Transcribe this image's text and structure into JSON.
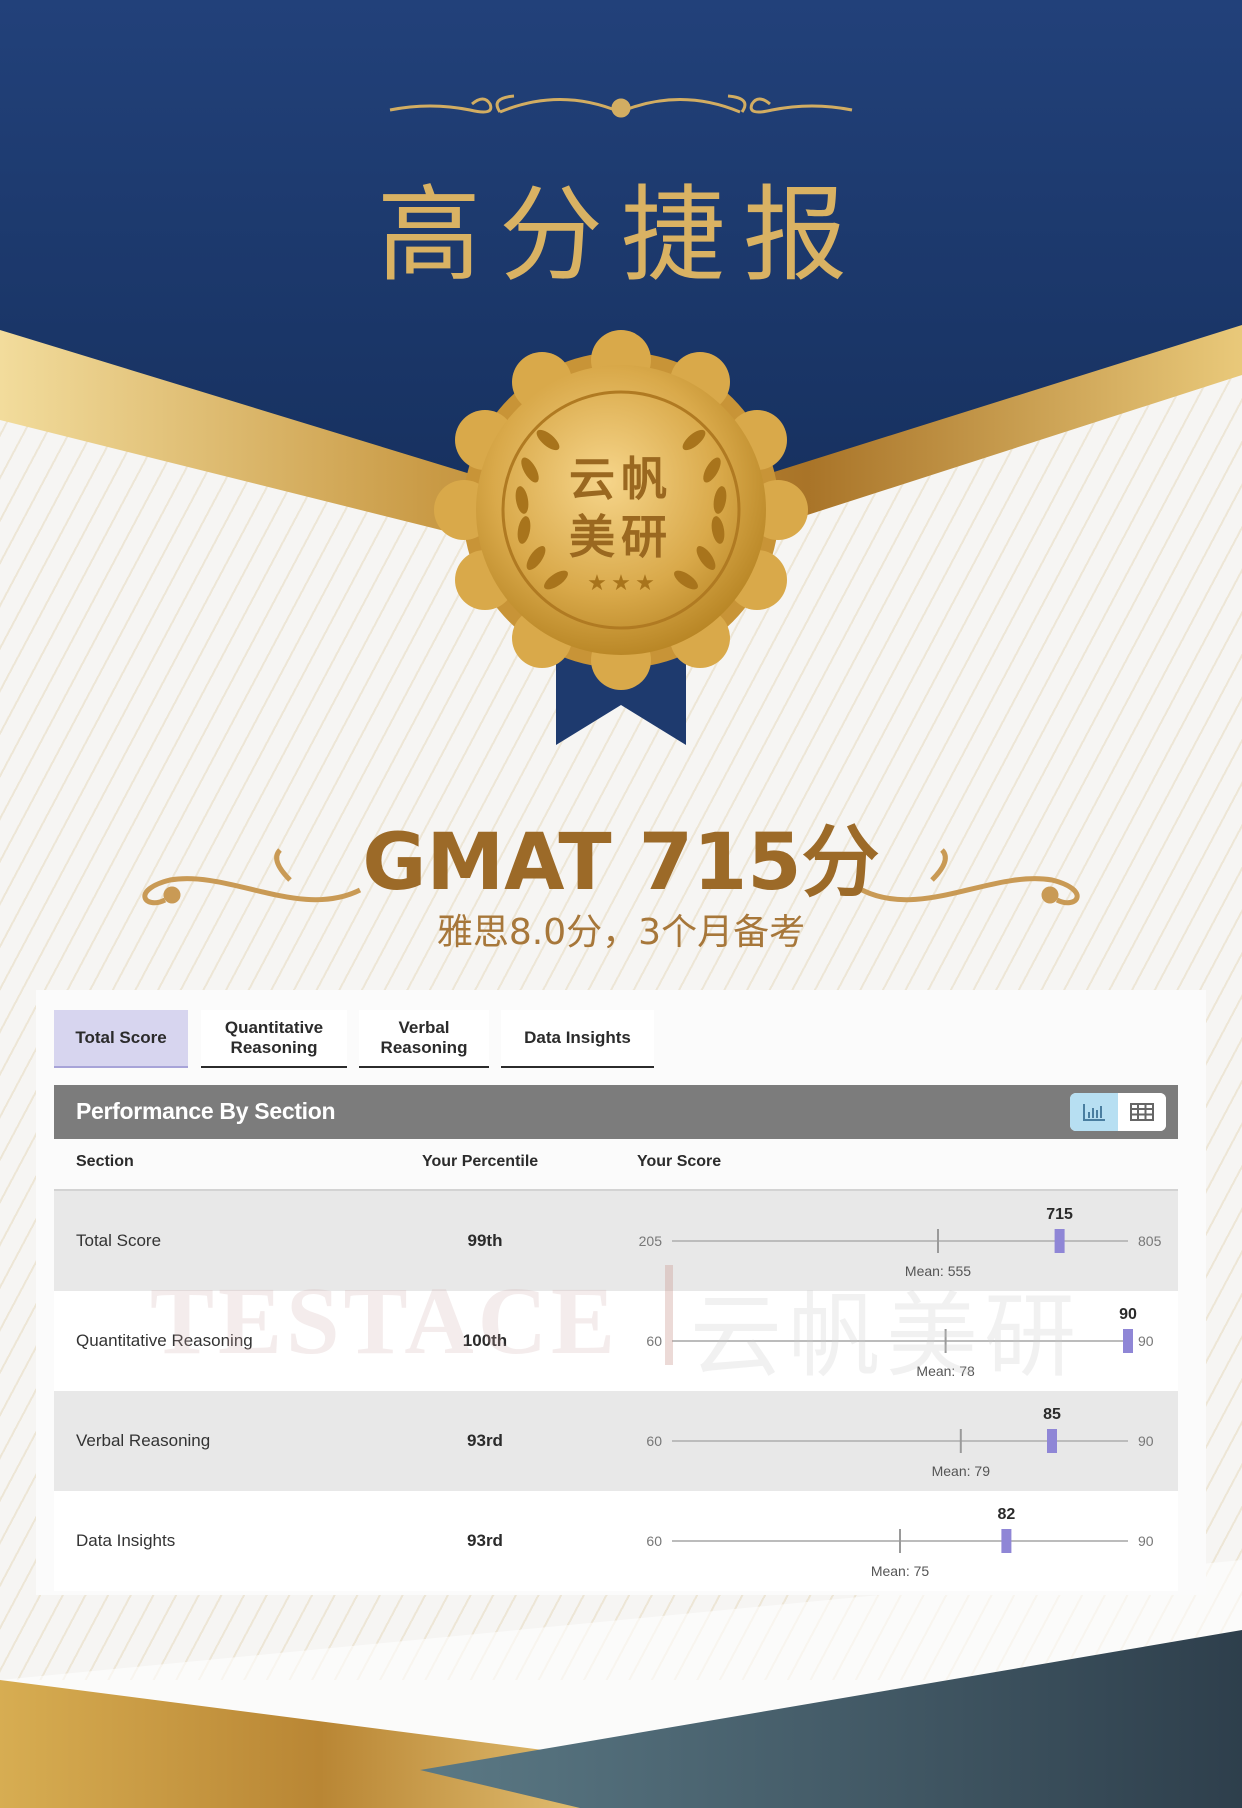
{
  "poster": {
    "title": "高分捷报",
    "seal_line1": "云帆",
    "seal_line2": "美研",
    "headline": "GMAT 715分",
    "subline": "雅思8.0分，3个月备考",
    "watermark_en": "TESTACE",
    "watermark_cn": "云帆美研"
  },
  "colors": {
    "navy": "#1f3a6e",
    "gold": "#d9b263",
    "accent_purple": "#8f86d6"
  },
  "tabs": [
    {
      "label": "Total Score",
      "active": true
    },
    {
      "label": "Quantitative Reasoning",
      "active": false
    },
    {
      "label": "Verbal Reasoning",
      "active": false
    },
    {
      "label": "Data Insights",
      "active": false
    }
  ],
  "performance": {
    "title": "Performance By Section",
    "chart_view_icon": "bar-chart-icon",
    "table_view_icon": "table-grid-icon",
    "columns": {
      "section": "Section",
      "percentile": "Your Percentile",
      "score": "Your Score"
    },
    "rows": [
      {
        "section": "Total Score",
        "percentile": "99th",
        "min": 205,
        "max": 805,
        "score": 715,
        "mean": 555,
        "mean_label": "Mean: 555"
      },
      {
        "section": "Quantitative Reasoning",
        "percentile": "100th",
        "min": 60,
        "max": 90,
        "score": 90,
        "mean": 78,
        "mean_label": "Mean: 78"
      },
      {
        "section": "Verbal Reasoning",
        "percentile": "93rd",
        "min": 60,
        "max": 90,
        "score": 85,
        "mean": 79,
        "mean_label": "Mean: 79"
      },
      {
        "section": "Data Insights",
        "percentile": "93rd",
        "min": 60,
        "max": 90,
        "score": 82,
        "mean": 75,
        "mean_label": "Mean: 75"
      }
    ]
  }
}
